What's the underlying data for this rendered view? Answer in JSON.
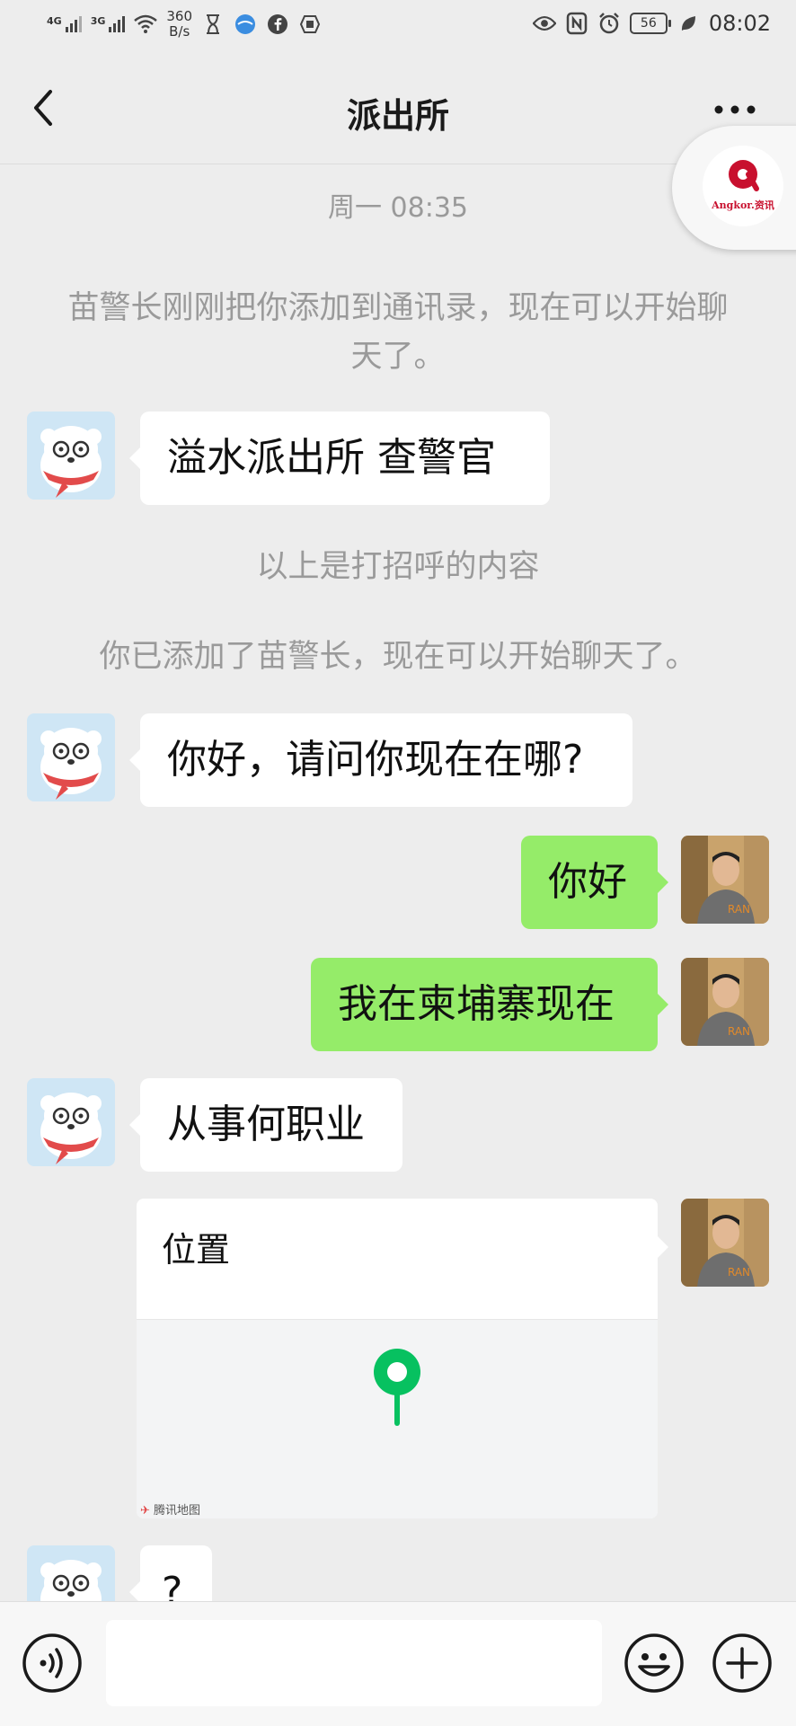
{
  "status_bar": {
    "signal_1": "4G",
    "signal_2": "3G",
    "speed_value": "360",
    "speed_unit": "B/s",
    "battery": "56",
    "time": "08:02"
  },
  "nav": {
    "title": "派出所"
  },
  "floating_widget": {
    "label": "Angkor.资讯"
  },
  "chat": {
    "timestamp": "周一 08:35",
    "system_added_contact": "苗警长刚刚把你添加到通讯录，现在可以开始聊天了。",
    "greeting_message": "溢水派出所  查警官",
    "system_greeting_note": "以上是打招呼的内容",
    "system_you_added": "你已添加了苗警长，现在可以开始聊天了。",
    "msg_where": "你好，请问你现在在哪?",
    "reply_hello": "你好",
    "reply_location": "我在柬埔寨现在",
    "msg_job": "从事何职业",
    "location_card_title": "位置",
    "map_caption": "腾讯地图",
    "msg_question": "?"
  },
  "colors": {
    "background": "#ededed",
    "incoming_bubble": "#ffffff",
    "outgoing_bubble": "#95ec69",
    "map_pin": "#07c160",
    "widget_accent": "#c8102e"
  },
  "icons": {
    "back": "chevron-left-icon",
    "more": "more-dots-icon",
    "voice": "voice-icon",
    "emoji": "emoji-icon",
    "plus": "plus-icon",
    "pin": "map-pin-icon"
  }
}
